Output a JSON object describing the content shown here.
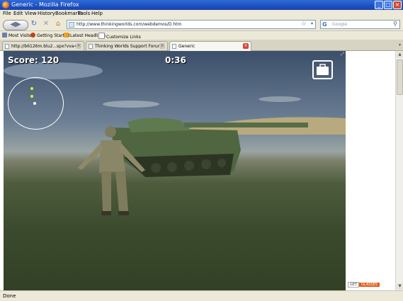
{
  "window": {
    "title": "Generic - Mozilla Firefox"
  },
  "menu": [
    "File",
    "Edit",
    "View",
    "History",
    "Bookmarks",
    "Tools",
    "Help"
  ],
  "nav": {
    "url": "http://www.thinkingworlds.com/webdemos/D.htm",
    "search_placeholder": "Google"
  },
  "bookmarks": [
    "Most Visited",
    "Getting Started",
    "Latest Headlines",
    "Customize Links"
  ],
  "tabs": [
    {
      "label": "http://b6126m.blu2...spx?vva=signin1.0",
      "active": false
    },
    {
      "label": "Thinking Worlds  Support Forum • Index",
      "active": false
    },
    {
      "label": "Generic",
      "active": true
    }
  ],
  "game": {
    "score": "Score: 120",
    "timer": "0:36",
    "minimap_dots": [
      {
        "color": "#e8f020"
      },
      {
        "color": "#e8f020"
      },
      {
        "color": "#ffffff"
      }
    ]
  },
  "badge": {
    "left": "GET",
    "right": "GLASSES"
  },
  "status": {
    "text": "Done"
  },
  "icons": {
    "back": "back-arrow-icon",
    "reload": "reload-icon",
    "stop": "stop-icon",
    "home": "home-icon",
    "briefcase": "briefcase-icon"
  }
}
